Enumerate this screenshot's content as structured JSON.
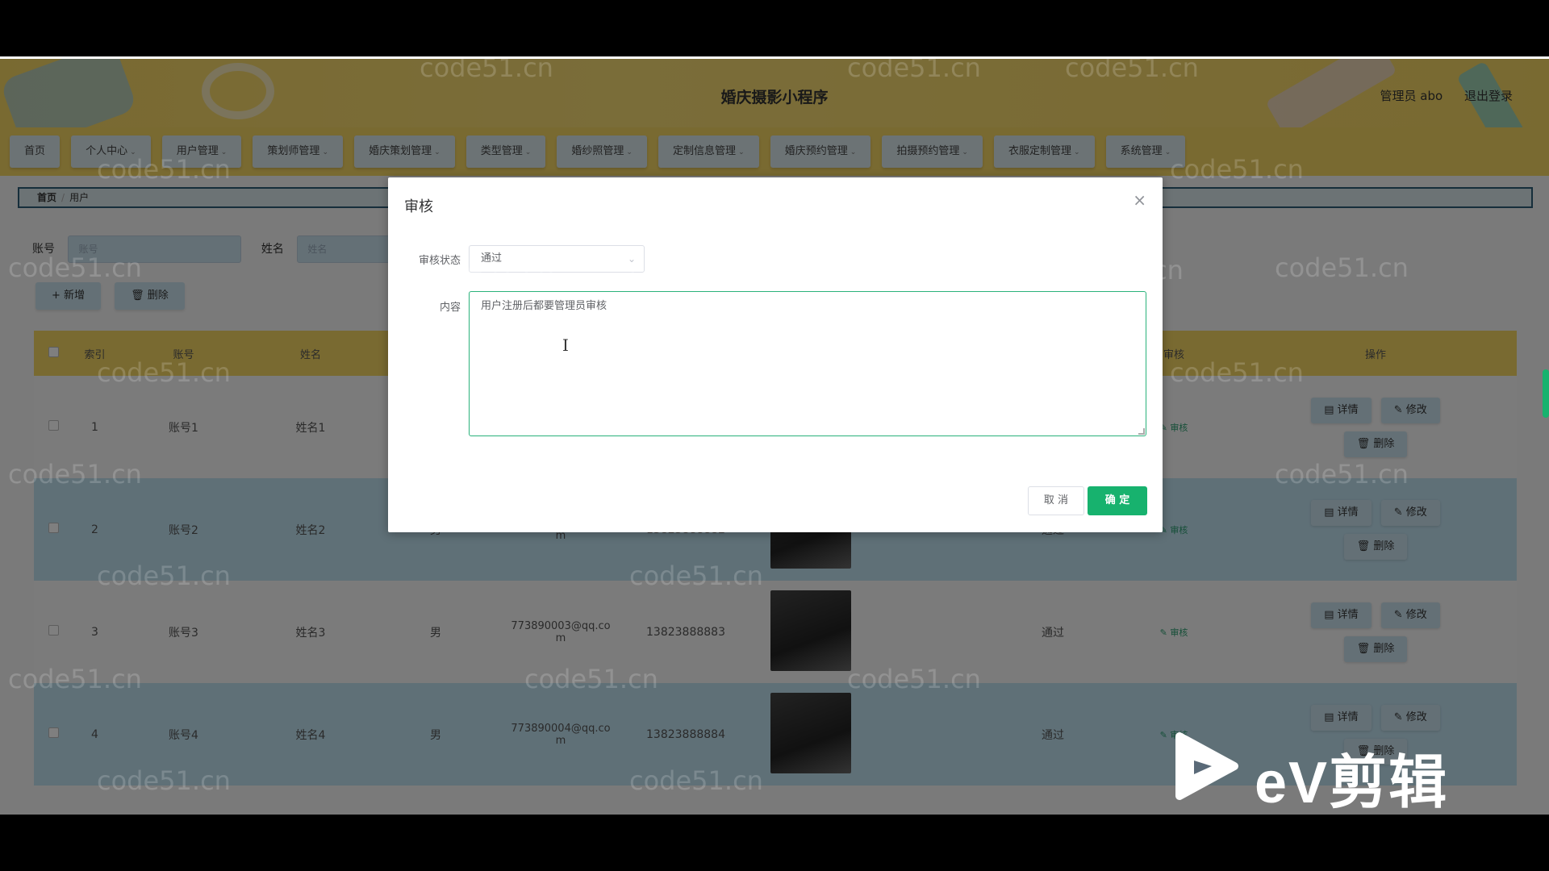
{
  "header": {
    "app_title": "婚庆摄影小程序",
    "user_label": "管理员 abo",
    "logout_label": "退出登录"
  },
  "nav": {
    "items": [
      "首页",
      "个人中心",
      "用户管理",
      "策划师管理",
      "婚庆策划管理",
      "类型管理",
      "婚纱照管理",
      "定制信息管理",
      "婚庆预约管理",
      "拍摄预约管理",
      "衣服定制管理",
      "系统管理"
    ]
  },
  "breadcrumb": {
    "home": "首页",
    "current": "用户"
  },
  "search": {
    "account_label": "账号",
    "account_placeholder": "账号",
    "name_label": "姓名",
    "name_placeholder": "姓名"
  },
  "toolbar": {
    "add_label": "+ 新增",
    "delete_label": "删除"
  },
  "table": {
    "headers": {
      "index": "索引",
      "account": "账号",
      "name": "姓名",
      "audit": "审核",
      "ops": "操作"
    },
    "rows": [
      {
        "index": "1",
        "account": "账号1",
        "name": "姓名1",
        "sex": "",
        "email": "",
        "phone": "",
        "state": "",
        "audit": "审核"
      },
      {
        "index": "2",
        "account": "账号2",
        "name": "姓名2",
        "sex": "男",
        "email": "773890002@qq.com",
        "phone": "13823888882",
        "state": "通过",
        "audit": "审核"
      },
      {
        "index": "3",
        "account": "账号3",
        "name": "姓名3",
        "sex": "男",
        "email": "773890003@qq.com",
        "phone": "13823888883",
        "state": "通过",
        "audit": "审核"
      },
      {
        "index": "4",
        "account": "账号4",
        "name": "姓名4",
        "sex": "男",
        "email": "773890004@qq.com",
        "phone": "13823888884",
        "state": "通过",
        "audit": "审核"
      }
    ],
    "ops": {
      "detail": "详情",
      "edit": "修改",
      "delete": "删除"
    }
  },
  "dialog": {
    "title": "审核",
    "status_label": "审核状态",
    "status_value": "通过",
    "content_label": "内容",
    "content_value": "用户注册后都要管理员审核",
    "cancel_label": "取 消",
    "confirm_label": "确 定"
  },
  "watermark_text": "code51.cn",
  "overlay_logo": "eV剪辑",
  "colors": {
    "primary": "#17b26e",
    "header": "#f3d463",
    "row_alt": "#bfe0ef"
  }
}
